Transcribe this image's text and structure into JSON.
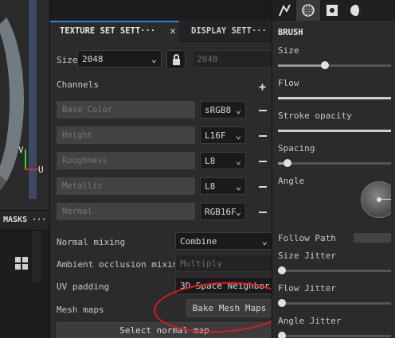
{
  "masks": {
    "title": "MASKS",
    "menu": "···"
  },
  "viewport": {
    "axis_v": "V",
    "axis_u": "U"
  },
  "texture_panel": {
    "tab_active": "TEXTURE SET SETT···",
    "tab_inactive": "DISPLAY SETT···",
    "close_glyph": "✕",
    "size_label": "Size",
    "size_value": "2048",
    "size_value_locked": "2048",
    "channels_label": "Channels",
    "add_glyph": "+",
    "channels": [
      {
        "name": "Base Color",
        "format": "sRGB8"
      },
      {
        "name": "Height",
        "format": "L16F"
      },
      {
        "name": "Roughness",
        "format": "L8"
      },
      {
        "name": "Metallic",
        "format": "L8"
      },
      {
        "name": "Normal",
        "format": "RGB16F"
      }
    ],
    "normal_mixing_label": "Normal mixing",
    "normal_mixing_value": "Combine",
    "ao_mixing_label": "Ambient occlusion mixing",
    "ao_mixing_value": "Multiply",
    "uv_padding_label": "UV padding",
    "uv_padding_value": "3D Space Neighbor",
    "mesh_maps_label": "Mesh maps",
    "bake_button": "Bake Mesh Maps",
    "select_normal_button": "Select normal map"
  },
  "brush_panel": {
    "title": "BRUSH",
    "size_label": "Size",
    "flow_label": "Flow",
    "stroke_opacity_label": "Stroke opacity",
    "spacing_label": "Spacing",
    "angle_label": "Angle",
    "follow_path_label": "Follow Path",
    "size_jitter_label": "Size Jitter",
    "flow_jitter_label": "Flow Jitter",
    "angle_jitter_label": "Angle Jitter",
    "size_value": 0.4,
    "spacing_value": 0.08,
    "size_jitter_value": 0.03,
    "flow_jitter_value": 0.03,
    "angle_jitter_value": 0.03
  },
  "colors": {
    "accent": "#2f7ee6",
    "annotation": "#e21a1a"
  }
}
